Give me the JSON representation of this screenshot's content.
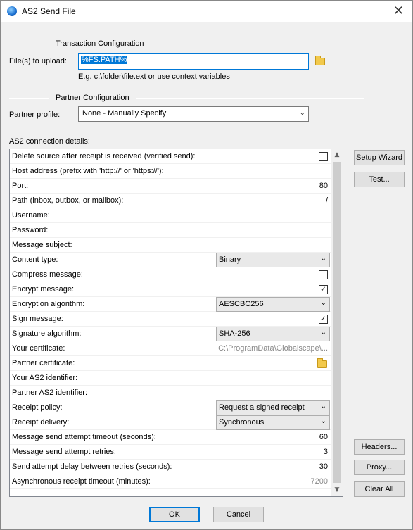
{
  "window": {
    "title": "AS2 Send File",
    "close_glyph": "✕",
    "icon": "globe-icon"
  },
  "transaction": {
    "section_title": "Transaction Configuration",
    "files_label": "File(s) to upload:",
    "files_value": "%FS.PATH%",
    "hint": "E.g. c:\\folder\\file.ext or use context variables"
  },
  "partner": {
    "section_title": "Partner Configuration",
    "profile_label": "Partner profile:",
    "profile_value": "None - Manually Specify"
  },
  "connection": {
    "label": "AS2 connection details:",
    "rows": [
      {
        "name": "Delete source after receipt is received (verified send):",
        "type": "checkbox",
        "checked": false
      },
      {
        "name": "Host address (prefix with 'http://' or 'https://'):",
        "type": "text",
        "value": ""
      },
      {
        "name": "Port:",
        "type": "text",
        "value": "80"
      },
      {
        "name": "Path (inbox, outbox, or mailbox):",
        "type": "text",
        "value": "/"
      },
      {
        "name": "Username:",
        "type": "text",
        "value": ""
      },
      {
        "name": "Password:",
        "type": "text",
        "value": ""
      },
      {
        "name": "Message subject:",
        "type": "text",
        "value": ""
      },
      {
        "name": "Content type:",
        "type": "combo",
        "value": "Binary"
      },
      {
        "name": "Compress message:",
        "type": "checkbox",
        "checked": false
      },
      {
        "name": "Encrypt message:",
        "type": "checkbox",
        "checked": true
      },
      {
        "name": "Encryption algorithm:",
        "type": "combo",
        "value": "AESCBC256"
      },
      {
        "name": "Sign message:",
        "type": "checkbox",
        "checked": true
      },
      {
        "name": "Signature algorithm:",
        "type": "combo",
        "value": "SHA-256"
      },
      {
        "name": "Your certificate:",
        "type": "gray",
        "value": "C:\\ProgramData\\Globalscape\\..."
      },
      {
        "name": "Partner certificate:",
        "type": "folder",
        "value": ""
      },
      {
        "name": "Your AS2 identifier:",
        "type": "text",
        "value": ""
      },
      {
        "name": "Partner AS2 identifier:",
        "type": "text",
        "value": ""
      },
      {
        "name": "Receipt policy:",
        "type": "combo",
        "value": "Request a signed receipt"
      },
      {
        "name": "Receipt delivery:",
        "type": "combo",
        "value": "Synchronous"
      },
      {
        "name": "Message send attempt timeout (seconds):",
        "type": "text",
        "value": "60"
      },
      {
        "name": "Message send attempt retries:",
        "type": "text",
        "value": "3"
      },
      {
        "name": "Send attempt delay between retries (seconds):",
        "type": "text",
        "value": "30"
      },
      {
        "name": "Asynchronous receipt timeout (minutes):",
        "type": "gray",
        "value": "7200"
      }
    ]
  },
  "side_buttons": {
    "setup_wizard": "Setup Wizard",
    "test": "Test...",
    "headers": "Headers...",
    "proxy": "Proxy...",
    "clear_all": "Clear All"
  },
  "footer": {
    "ok": "OK",
    "cancel": "Cancel"
  }
}
